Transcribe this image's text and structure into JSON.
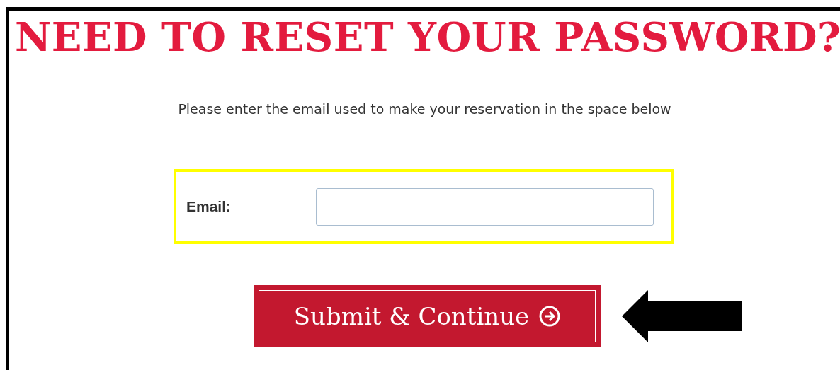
{
  "title": "NEED TO RESET YOUR PASSWORD?",
  "instructions": "Please enter the email used to make your reservation in the space below",
  "email_field": {
    "label": "Email:"
  },
  "submit_button": {
    "label": "Submit & Continue"
  }
}
